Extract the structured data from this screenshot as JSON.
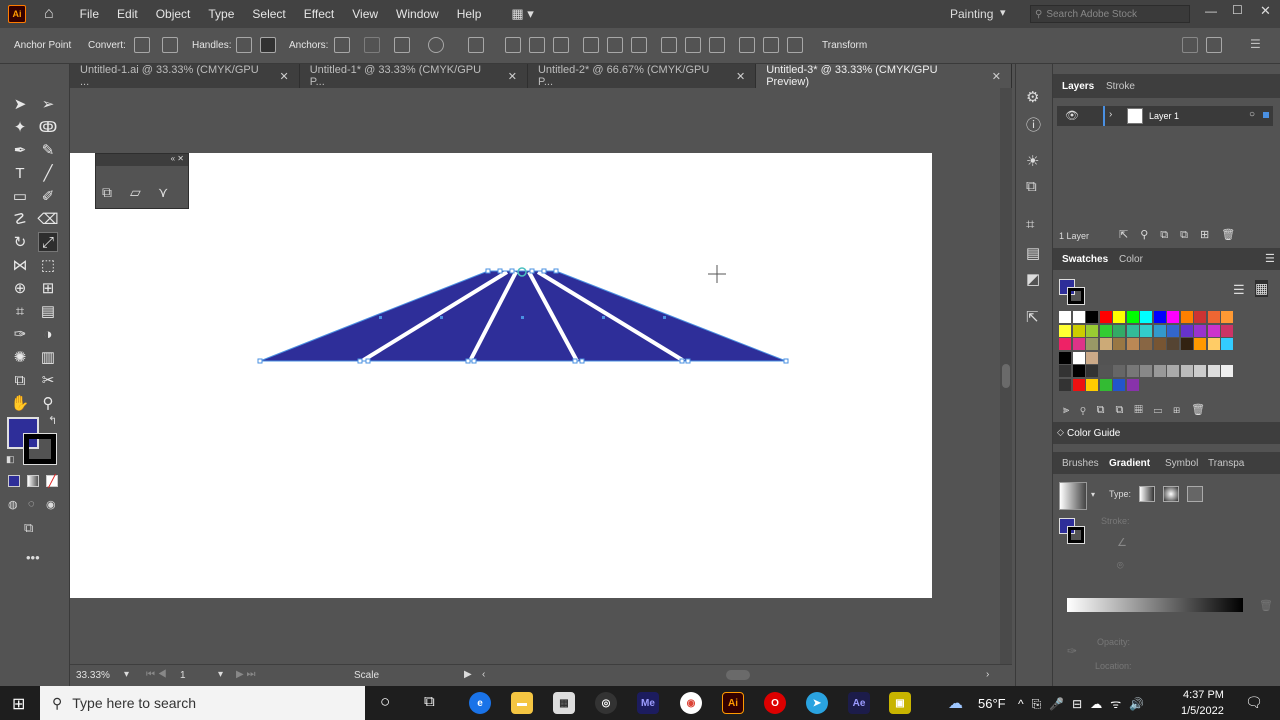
{
  "menubar": {
    "app_icon": "Ai",
    "items": [
      "File",
      "Edit",
      "Object",
      "Type",
      "Select",
      "Effect",
      "View",
      "Window",
      "Help"
    ],
    "workspace": "Painting",
    "search_placeholder": "Search Adobe Stock"
  },
  "controlbar": {
    "anchor_point": "Anchor Point",
    "convert": "Convert:",
    "handles": "Handles:",
    "anchors": "Anchors:",
    "transform": "Transform"
  },
  "tabs": [
    {
      "label": "Untitled-1.ai @ 33.33% (CMYK/GPU ...",
      "active": false
    },
    {
      "label": "Untitled-1* @ 33.33% (CMYK/GPU P...",
      "active": false
    },
    {
      "label": "Untitled-2* @ 66.67% (CMYK/GPU P...",
      "active": false
    },
    {
      "label": "Untitled-3* @ 33.33% (CMYK/GPU Preview)",
      "active": true
    }
  ],
  "status": {
    "zoom": "33.33%",
    "artboard_num": "1",
    "tool_name": "Scale"
  },
  "colors": {
    "fill": "#2e2e99",
    "artwork": "#2e2e99",
    "selection": "#4a90e2"
  },
  "panels": {
    "layers_tab": "Layers",
    "stroke_tab": "Stroke",
    "layer_name": "Layer 1",
    "layer_count": "1 Layer",
    "swatches_tab": "Swatches",
    "color_tab": "Color",
    "color_guide": "Color Guide",
    "brushes_tab": "Brushes",
    "gradient_tab": "Gradient",
    "symbol_tab": "Symbol",
    "transparency_tab": "Transpa",
    "type_label": "Type:",
    "stroke_label": "Stroke:",
    "opacity_label": "Opacity:",
    "location_label": "Location:"
  },
  "taskbar": {
    "search_placeholder": "Type here to search",
    "weather": "56°F",
    "time": "4:37 PM",
    "date": "1/5/2022",
    "apps": [
      "Me",
      "Ai",
      "Ae"
    ]
  }
}
